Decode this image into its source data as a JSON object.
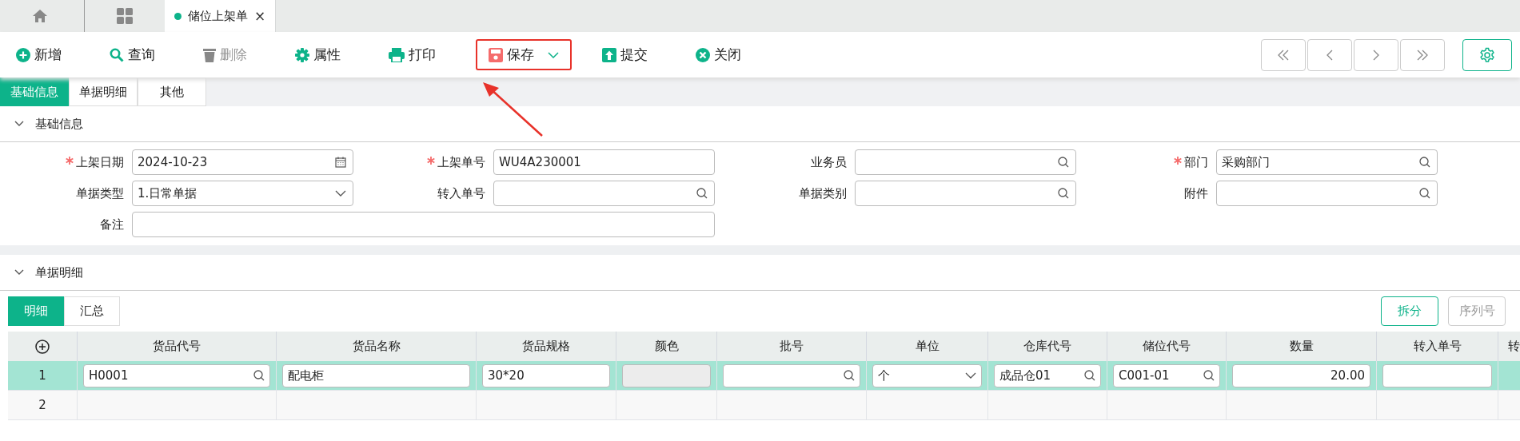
{
  "tabs": [
    {
      "kind": "home",
      "selected": false
    },
    {
      "kind": "apps",
      "selected": false
    },
    {
      "kind": "page",
      "label": "储位上架单",
      "selected": true,
      "close": "×"
    }
  ],
  "toolbar": [
    {
      "label": "新增",
      "kind": "plus",
      "disabled": false,
      "highlighted": false,
      "dropdown": false
    },
    {
      "label": "查询",
      "kind": "search",
      "disabled": false,
      "highlighted": false,
      "dropdown": false
    },
    {
      "label": "删除",
      "kind": "trash",
      "disabled": true,
      "highlighted": false,
      "dropdown": false
    },
    {
      "label": "属性",
      "kind": "gear",
      "disabled": false,
      "highlighted": false,
      "dropdown": false
    },
    {
      "label": "打印",
      "kind": "printer",
      "disabled": false,
      "highlighted": false,
      "dropdown": false
    },
    {
      "label": "保存",
      "kind": "save",
      "disabled": false,
      "highlighted": true,
      "dropdown": true
    },
    {
      "label": "提交",
      "kind": "submit",
      "disabled": false,
      "highlighted": false,
      "dropdown": false
    },
    {
      "label": "关闭",
      "kind": "close",
      "disabled": false,
      "highlighted": false,
      "dropdown": false
    }
  ],
  "form_tabs": [
    {
      "label": "基础信息",
      "selected": true
    },
    {
      "label": "单据明细",
      "selected": false
    },
    {
      "label": "其他",
      "selected": false
    }
  ],
  "basic_section": {
    "title": "基础信息",
    "expanded": true,
    "fields": [
      {
        "label": "上架日期",
        "required": true,
        "kind": "date",
        "value": "2024-10-23"
      },
      {
        "label": "上架单号",
        "required": true,
        "kind": "text",
        "value": "WU4A230001"
      },
      {
        "label": "业务员",
        "required": false,
        "kind": "search"
      },
      {
        "label": "部门",
        "required": true,
        "kind": "search",
        "value": "采购部门"
      },
      {
        "label": "单据类型",
        "required": false,
        "kind": "select",
        "value": "1.日常单据"
      },
      {
        "label": "转入单号",
        "required": false,
        "kind": "search"
      },
      {
        "label": "单据类别",
        "required": false,
        "kind": "search"
      },
      {
        "label": "附件",
        "required": false,
        "kind": "search"
      },
      {
        "label": "备注",
        "required": false,
        "kind": "long"
      }
    ]
  },
  "detail_section": {
    "title": "单据明细",
    "expanded": true,
    "tabs": [
      {
        "label": "明细",
        "selected": true
      },
      {
        "label": "汇总",
        "selected": false
      }
    ],
    "buttons": [
      {
        "label": "拆分",
        "disabled": false
      },
      {
        "label": "序列号",
        "disabled": true
      }
    ],
    "columns": [
      {
        "label": "货品代号",
        "kind": "search"
      },
      {
        "label": "货品名称",
        "kind": "text"
      },
      {
        "label": "货品规格",
        "kind": "text"
      },
      {
        "label": "颜色",
        "kind": "disabled"
      },
      {
        "label": "批号",
        "kind": "search"
      },
      {
        "label": "单位",
        "kind": "select"
      },
      {
        "label": "仓库代号",
        "kind": "search"
      },
      {
        "label": "储位代号",
        "kind": "search"
      },
      {
        "label": "数量",
        "kind": "number"
      },
      {
        "label": "转入单号",
        "kind": "text"
      },
      {
        "label": "转"
      }
    ],
    "rows": [
      {
        "index": "1",
        "selected": true,
        "cells": [
          {
            "value": "H0001"
          },
          {
            "value": "配电柜"
          },
          {
            "value": "30*20"
          },
          {},
          {},
          {
            "value": "个"
          },
          {
            "value": "成品仓01"
          },
          {
            "value": "C001-01"
          },
          {
            "value": "20.00"
          },
          {}
        ]
      },
      {
        "index": "2",
        "selected": false
      }
    ]
  }
}
